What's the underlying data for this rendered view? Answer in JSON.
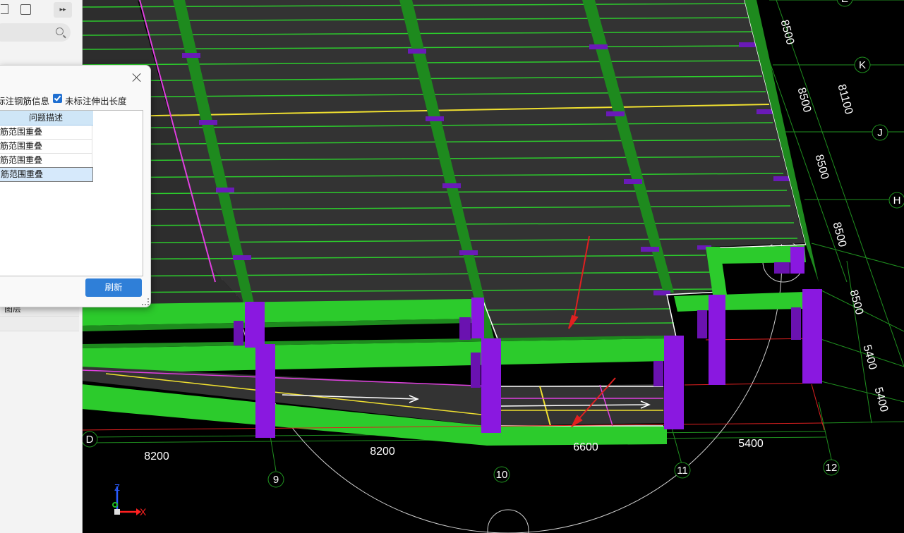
{
  "panel": {
    "layer_label": "图层",
    "row_label": "图"
  },
  "dialog": {
    "option1": "标注钢筋信息",
    "option2": "未标注伸出长度",
    "option2_checked": true,
    "table": {
      "header": "问题描述",
      "rows": [
        "筋范围重叠",
        "筋范围重叠",
        "筋范围重叠",
        "筋范围重叠"
      ],
      "selected_index": 3
    },
    "refresh_label": "刷新"
  },
  "scene": {
    "grid_labels": {
      "rows": [
        "E",
        "K",
        "J",
        "H",
        "D"
      ],
      "cols": [
        "9",
        "10",
        "11",
        "12"
      ]
    },
    "dims_right": [
      "8500",
      "8500",
      "81100",
      "8500",
      "8500",
      "8500",
      "5400",
      "5400"
    ],
    "dims_bottom": [
      "8200",
      "8200",
      "6600",
      "5400"
    ],
    "axis": {
      "x": "X",
      "z": "Z"
    },
    "colors": {
      "slab": "#333333",
      "beam": "#2ccb2c",
      "beam_dark": "#1e8a1e",
      "column": "#8a18e0",
      "magenta": "#e040e0",
      "yellow": "#f0e030",
      "grid": "#1f8f1f",
      "red": "#e02020"
    }
  }
}
